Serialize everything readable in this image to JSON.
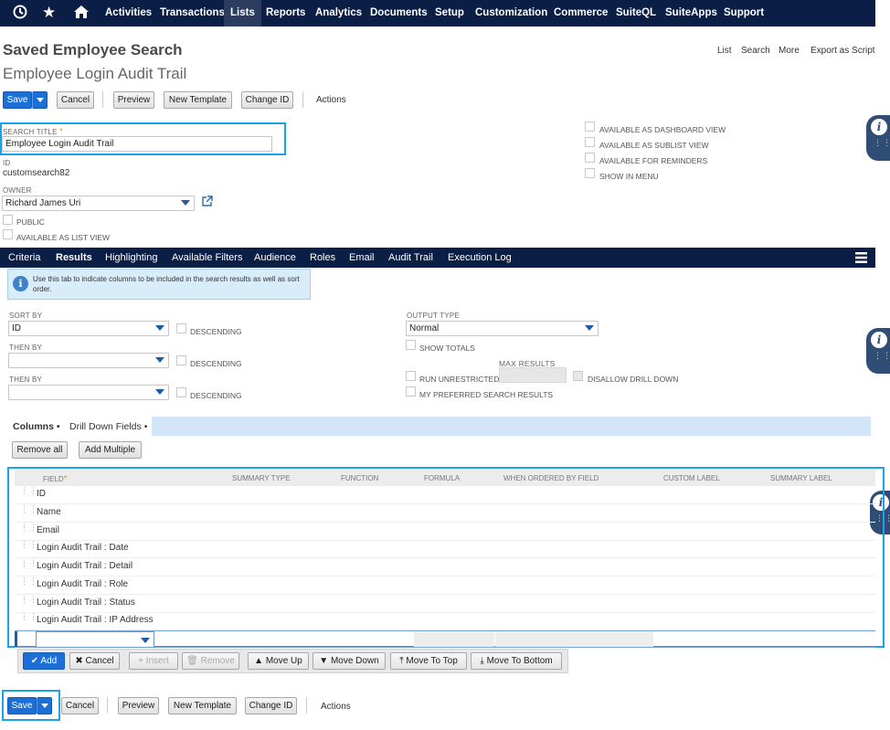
{
  "nav": {
    "items": [
      "Activities",
      "Transactions",
      "Lists",
      "Reports",
      "Analytics",
      "Documents",
      "Setup",
      "Customization",
      "Commerce",
      "SuiteQL",
      "SuiteApps",
      "Support"
    ],
    "active": "Lists"
  },
  "header": {
    "record_type": "Saved Employee Search",
    "record_name": "Employee Login Audit Trail",
    "links": [
      "List",
      "Search",
      "More",
      "Export as Script"
    ]
  },
  "buttons": {
    "save": "Save",
    "cancel": "Cancel",
    "preview": "Preview",
    "new_template": "New Template",
    "change_id": "Change ID",
    "actions": "Actions"
  },
  "form": {
    "search_title_label": "SEARCH TITLE",
    "required_mark": "*",
    "search_title_value": "Employee Login Audit Trail",
    "id_label": "ID",
    "id_value": "customsearch82",
    "owner_label": "OWNER",
    "owner_value": "Richard James Uri",
    "public_label": "PUBLIC",
    "available_list_view": "AVAILABLE AS LIST VIEW",
    "available_dashboard": "AVAILABLE AS DASHBOARD VIEW",
    "available_sublist": "AVAILABLE AS SUBLIST VIEW",
    "available_reminders": "AVAILABLE FOR REMINDERS",
    "show_in_menu": "SHOW IN MENU"
  },
  "tabs": [
    "Criteria",
    "Results",
    "Highlighting",
    "Available Filters",
    "Audience",
    "Roles",
    "Email",
    "Audit Trail",
    "Execution Log"
  ],
  "results": {
    "info_text": "Use this tab to indicate columns to be included in the search results as well as sort order.",
    "sort_by_label": "SORT BY",
    "sort_by_value": "ID",
    "then_by_label": "THEN BY",
    "descending": "DESCENDING",
    "output_type_label": "OUTPUT TYPE",
    "output_type_value": "Normal",
    "show_totals": "SHOW TOTALS",
    "max_results_label": "MAX RESULTS",
    "run_unrestricted": "RUN UNRESTRICTED",
    "disallow_drill_down": "DISALLOW DRILL DOWN",
    "preferred_results": "MY PREFERRED SEARCH RESULTS"
  },
  "subtabs": [
    "Columns",
    "Drill Down Fields"
  ],
  "subtab_bullet": "•",
  "column_buttons": {
    "remove_all": "Remove all",
    "add_multiple": "Add Multiple"
  },
  "columns": {
    "headers": [
      "FIELD",
      "SUMMARY TYPE",
      "FUNCTION",
      "FORMULA",
      "WHEN ORDERED BY FIELD",
      "CUSTOM LABEL",
      "SUMMARY LABEL"
    ],
    "rows": [
      "ID",
      "Name",
      "Email",
      "Login Audit Trail : Date",
      "Login Audit Trail : Detail",
      "Login Audit Trail : Role",
      "Login Audit Trail : Status",
      "Login Audit Trail : IP Address"
    ]
  },
  "row_actions": {
    "add": "Add",
    "cancel": "Cancel",
    "insert": "Insert",
    "remove": "Remove",
    "move_up": "Move Up",
    "move_down": "Move Down",
    "move_top": "Move To Top",
    "move_bottom": "Move To Bottom"
  },
  "colors": {
    "nav_bg": "#0b1e45",
    "accent_blue": "#1c6fd6",
    "highlight": "#1aa3e8",
    "info_bg": "#d9ecfa"
  },
  "icons": [
    "history-icon",
    "star-icon",
    "home-icon",
    "info-icon",
    "open-link-icon",
    "caret-down-icon",
    "grip-icon",
    "checkmark-icon"
  ]
}
